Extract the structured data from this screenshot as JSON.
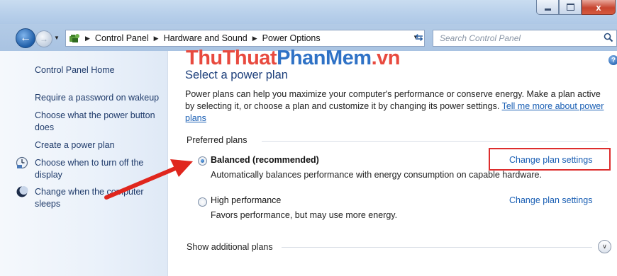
{
  "window": {
    "close_label": "x"
  },
  "nav": {
    "breadcrumbs": [
      "Control Panel",
      "Hardware and Sound",
      "Power Options"
    ],
    "search_placeholder": "Search Control Panel"
  },
  "sidebar": {
    "home": "Control Panel Home",
    "links": [
      {
        "label": "Require a password on wakeup",
        "icon": null
      },
      {
        "label": "Choose what the power button does",
        "icon": null
      },
      {
        "label": "Create a power plan",
        "icon": null
      },
      {
        "label": "Choose when to turn off the display",
        "icon": "display-schedule-icon"
      },
      {
        "label": "Change when the computer sleeps",
        "icon": "sleep-moon-icon"
      }
    ]
  },
  "watermark": {
    "part1": "ThuThuat",
    "part2": "PhanMem",
    "part3": ".vn"
  },
  "main": {
    "title": "Select a power plan",
    "intro": "Power plans can help you maximize your computer's performance or conserve energy. Make a plan active by selecting it, or choose a plan and customize it by changing its power settings.",
    "intro_link": "Tell me more about power plans",
    "group_header": "Preferred plans",
    "plans": [
      {
        "name": "Balanced (recommended)",
        "description": "Automatically balances performance with energy consumption on capable hardware.",
        "link": "Change plan settings",
        "selected": true
      },
      {
        "name": "High performance",
        "description": "Favors performance, but may use more energy.",
        "link": "Change plan settings",
        "selected": false
      }
    ],
    "show_additional": "Show additional plans"
  },
  "colors": {
    "link": "#1a5fb4",
    "title": "#1c3e7a",
    "highlight": "#dd2d2d",
    "arrow": "#e0261d"
  }
}
